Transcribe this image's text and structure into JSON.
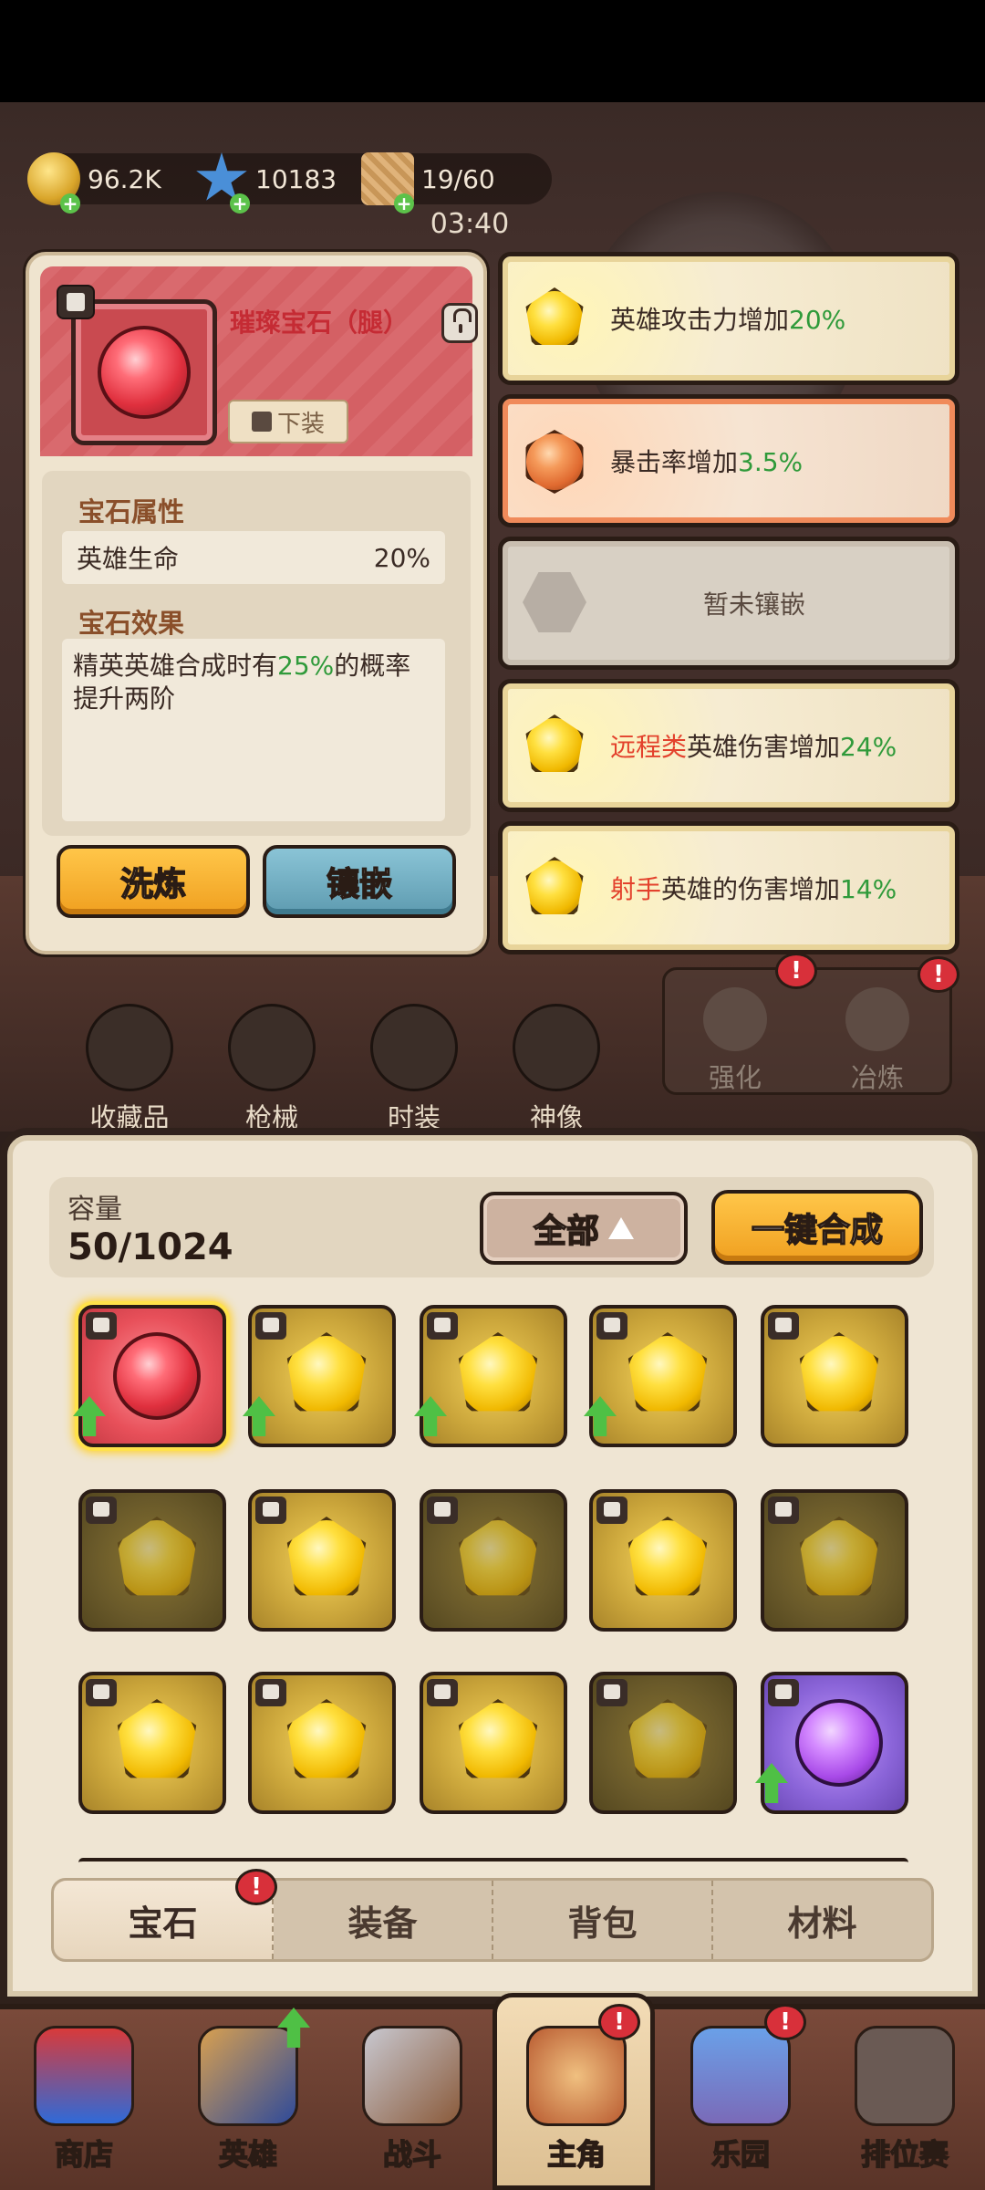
{
  "resources": [
    {
      "name": "coins",
      "value": "96.2K",
      "color": "#d9a52a"
    },
    {
      "name": "stars",
      "value": "10183",
      "color": "#4a8fd8"
    },
    {
      "name": "stamina",
      "value": "19/60",
      "color": "#d8a56a"
    }
  ],
  "timer": "03:40",
  "gem_detail": {
    "title": "璀璨宝石（腿）",
    "slot_tag": "下装",
    "attr_title": "宝石属性",
    "attr": {
      "name": "英雄生命",
      "value": "20%"
    },
    "effect_title": "宝石效果",
    "effect_parts": [
      "精英英雄合成时有",
      "25%",
      "的概率提升两阶"
    ],
    "refine_label": "洗炼",
    "inlay_label": "镶嵌"
  },
  "slots": [
    {
      "gem": "gold",
      "parts": [
        "英雄攻击力增加",
        "20%"
      ]
    },
    {
      "gem": "amber",
      "parts": [
        "暴击率增加",
        "3.5%"
      ]
    },
    {
      "gem": "empty",
      "parts": [
        "暂未镶嵌"
      ]
    },
    {
      "gem": "gold",
      "parts": [
        "远程类",
        "英雄伤害增加",
        "24%"
      ]
    },
    {
      "gem": "gold",
      "parts": [
        "射手",
        "英雄的伤害增加",
        "14%"
      ]
    }
  ],
  "features": [
    "收藏品",
    "枪械",
    "时装",
    "神像"
  ],
  "upgrade": [
    "强化",
    "冶炼"
  ],
  "inventory": {
    "capacity_label": "容量",
    "capacity_value": "50/1024",
    "filter_label": "全部",
    "merge_label": "一键合成",
    "cells": [
      {
        "type": "ruby",
        "bg": "r",
        "arrow": true
      },
      {
        "type": "gold",
        "bg": "g",
        "arrow": true
      },
      {
        "type": "gold",
        "bg": "g",
        "arrow": true
      },
      {
        "type": "gold",
        "bg": "g",
        "arrow": true
      },
      {
        "type": "gold",
        "bg": "g",
        "arrow": false
      },
      {
        "type": "gold",
        "bg": "d",
        "arrow": false
      },
      {
        "type": "gold",
        "bg": "g",
        "arrow": false
      },
      {
        "type": "gold",
        "bg": "d",
        "arrow": false
      },
      {
        "type": "gold",
        "bg": "g",
        "arrow": false
      },
      {
        "type": "gold",
        "bg": "d",
        "arrow": false
      },
      {
        "type": "gold",
        "bg": "g",
        "arrow": false
      },
      {
        "type": "gold",
        "bg": "g",
        "arrow": false
      },
      {
        "type": "gold",
        "bg": "g",
        "arrow": false
      },
      {
        "type": "gold",
        "bg": "d",
        "arrow": false
      },
      {
        "type": "violet",
        "bg": "p",
        "arrow": true
      }
    ]
  },
  "tabs": [
    "宝石",
    "装备",
    "背包",
    "材料"
  ],
  "nav": [
    "商店",
    "英雄",
    "战斗",
    "主角",
    "乐园",
    "排位赛"
  ]
}
